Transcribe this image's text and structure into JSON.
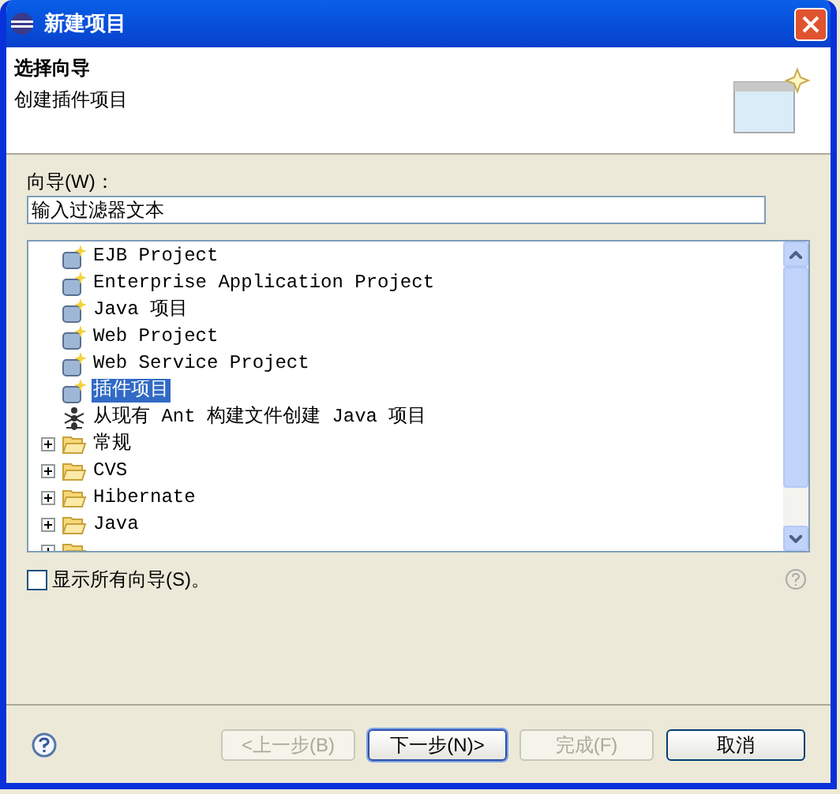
{
  "window": {
    "title": "新建项目"
  },
  "header": {
    "title": "选择向导",
    "description": "创建插件项目"
  },
  "filter": {
    "label": "向导(W)：",
    "value": "输入过滤器文本"
  },
  "tree": {
    "items": [
      {
        "kind": "wizard",
        "label": "EJB Project",
        "selected": false
      },
      {
        "kind": "wizard",
        "label": "Enterprise Application Project",
        "selected": false
      },
      {
        "kind": "wizard",
        "label": "Java 项目",
        "selected": false
      },
      {
        "kind": "wizard",
        "label": "Web Project",
        "selected": false
      },
      {
        "kind": "wizard",
        "label": "Web Service Project",
        "selected": false
      },
      {
        "kind": "wizard",
        "label": "插件项目",
        "selected": true
      },
      {
        "kind": "ant",
        "label": "从现有 Ant 构建文件创建 Java 项目",
        "selected": false
      },
      {
        "kind": "folder",
        "label": "常规",
        "expanded": false
      },
      {
        "kind": "folder",
        "label": "CVS",
        "expanded": false
      },
      {
        "kind": "folder",
        "label": "Hibernate",
        "expanded": false
      },
      {
        "kind": "folder",
        "label": "Java",
        "expanded": false
      },
      {
        "kind": "folder",
        "expanded": false
      }
    ]
  },
  "show_all": {
    "label": "显示所有向导(S)。",
    "checked": false
  },
  "buttons": [
    {
      "label": "<上一步(B)",
      "disabled": true,
      "default": false
    },
    {
      "label": "下一步(N)>",
      "disabled": false,
      "default": true
    },
    {
      "label": "完成(F)",
      "disabled": true,
      "default": false
    },
    {
      "label": "取消",
      "disabled": false,
      "default": false
    }
  ]
}
